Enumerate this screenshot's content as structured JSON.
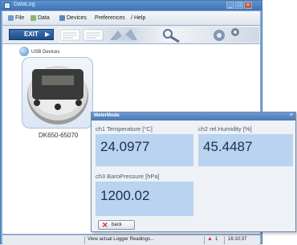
{
  "window": {
    "title": "DataLog"
  },
  "menu": {
    "items": [
      {
        "label": "File",
        "icon": "file-icon"
      },
      {
        "label": "Data",
        "icon": "data-icon"
      },
      {
        "label": "Devices",
        "icon": "devices-icon"
      },
      {
        "label": "Preferences",
        "icon": ""
      },
      {
        "label": "Help",
        "icon": "help-icon"
      }
    ]
  },
  "toolbar": {
    "exit_label": "EXIT"
  },
  "devices": {
    "section_label": "USB Devices",
    "device_id": "DK650-65070"
  },
  "status": {
    "text": "View actual Logger Readings...",
    "page": "1",
    "time": "16:10:37"
  },
  "meter": {
    "title": "MeterMode",
    "close": "×",
    "channels": [
      {
        "label": "ch1 Temperature  [°C]",
        "value": "24.0977"
      },
      {
        "label": "ch2 rel.Humidity  [%]",
        "value": "45.4487"
      },
      {
        "label": "ch3 BaroPressure [hPa]",
        "value": "1200.02"
      }
    ],
    "back_label": "back"
  },
  "colors": {
    "accent": "#3f73b3",
    "value_box": "#b9d3f0",
    "close_red": "#dd2222"
  }
}
